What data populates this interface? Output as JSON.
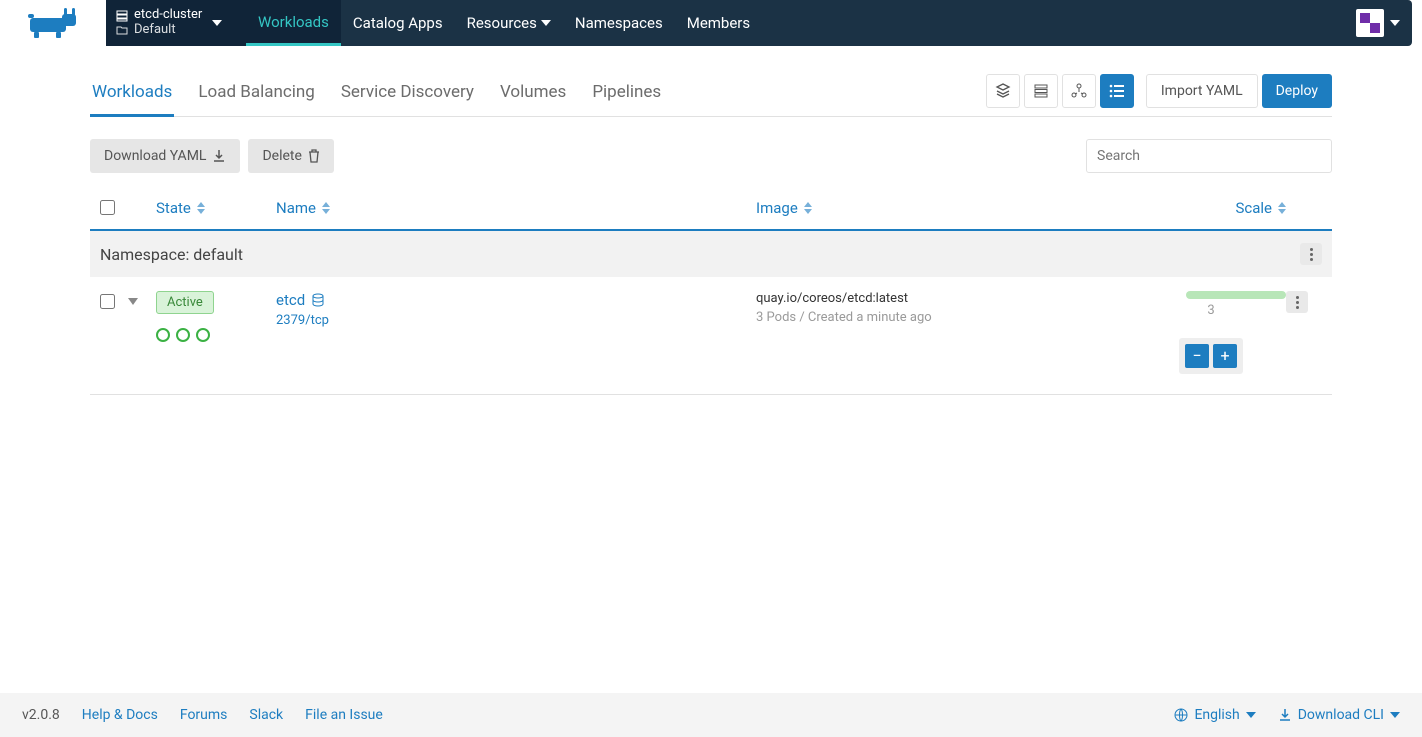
{
  "header": {
    "cluster_name": "etcd-cluster",
    "project_name": "Default",
    "nav": {
      "workloads": "Workloads",
      "catalog": "Catalog Apps",
      "resources": "Resources",
      "namespaces": "Namespaces",
      "members": "Members"
    }
  },
  "subnav": {
    "tabs": {
      "workloads": "Workloads",
      "lb": "Load Balancing",
      "sd": "Service Discovery",
      "vol": "Volumes",
      "pipe": "Pipelines"
    },
    "import_yaml": "Import YAML",
    "deploy": "Deploy"
  },
  "actions": {
    "download_yaml": "Download YAML",
    "delete": "Delete"
  },
  "search": {
    "placeholder": "Search"
  },
  "table": {
    "headers": {
      "state": "State",
      "name": "Name",
      "image": "Image",
      "scale": "Scale"
    },
    "namespace_label": "Namespace: default",
    "rows": [
      {
        "state": "Active",
        "name": "etcd",
        "port": "2379/tcp",
        "image": "quay.io/coreos/etcd:latest",
        "meta": "3 Pods / Created a minute ago",
        "scale": "3",
        "pod_count": 3
      }
    ]
  },
  "footer": {
    "version": "v2.0.8",
    "help": "Help & Docs",
    "forums": "Forums",
    "slack": "Slack",
    "issue": "File an Issue",
    "language": "English",
    "download_cli": "Download CLI"
  }
}
